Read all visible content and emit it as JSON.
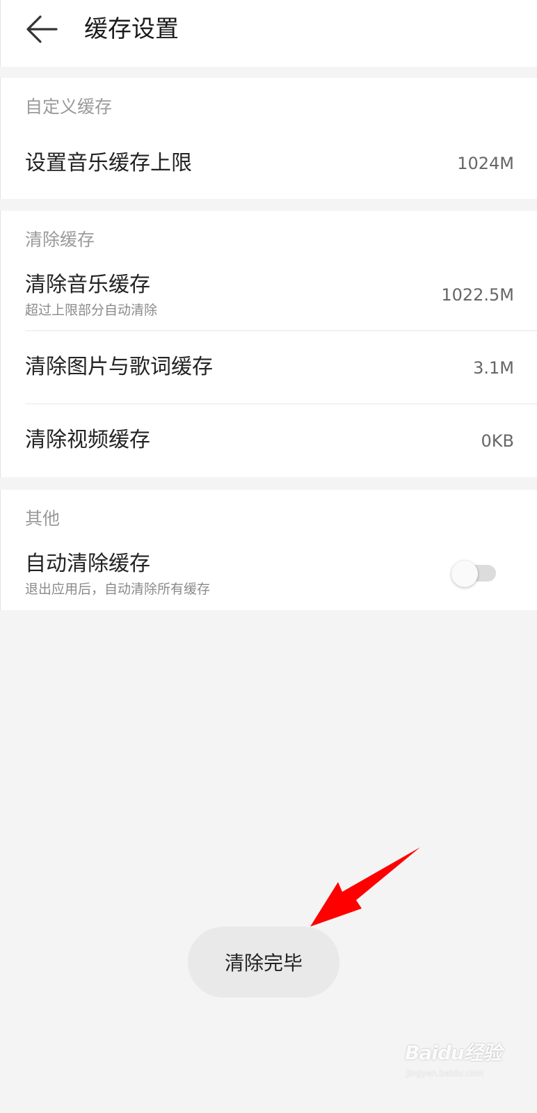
{
  "header": {
    "back_icon": "arrow-left-icon",
    "title": "缓存设置"
  },
  "sections": {
    "custom": {
      "label": "自定义缓存",
      "music_limit": {
        "title": "设置音乐缓存上限",
        "value": "1024M"
      }
    },
    "clear": {
      "label": "清除缓存",
      "music": {
        "title": "清除音乐缓存",
        "subtitle": "超过上限部分自动清除",
        "value": "1022.5M"
      },
      "images_lyrics": {
        "title": "清除图片与歌词缓存",
        "value": "3.1M"
      },
      "video": {
        "title": "清除视频缓存",
        "value": "0KB"
      }
    },
    "other": {
      "label": "其他",
      "auto_clear": {
        "title": "自动清除缓存",
        "subtitle": "退出应用后，自动清除所有缓存",
        "enabled": false
      }
    }
  },
  "toast": {
    "text": "清除完毕"
  },
  "annotation": {
    "arrow_color": "#ff0000"
  },
  "watermark": {
    "text": "Baidu经验",
    "subtext": "jingyan.baidu.com"
  },
  "colors": {
    "background": "#f4f4f4",
    "card": "#ffffff",
    "section_label": "#9a9a9a",
    "value": "#666666"
  }
}
